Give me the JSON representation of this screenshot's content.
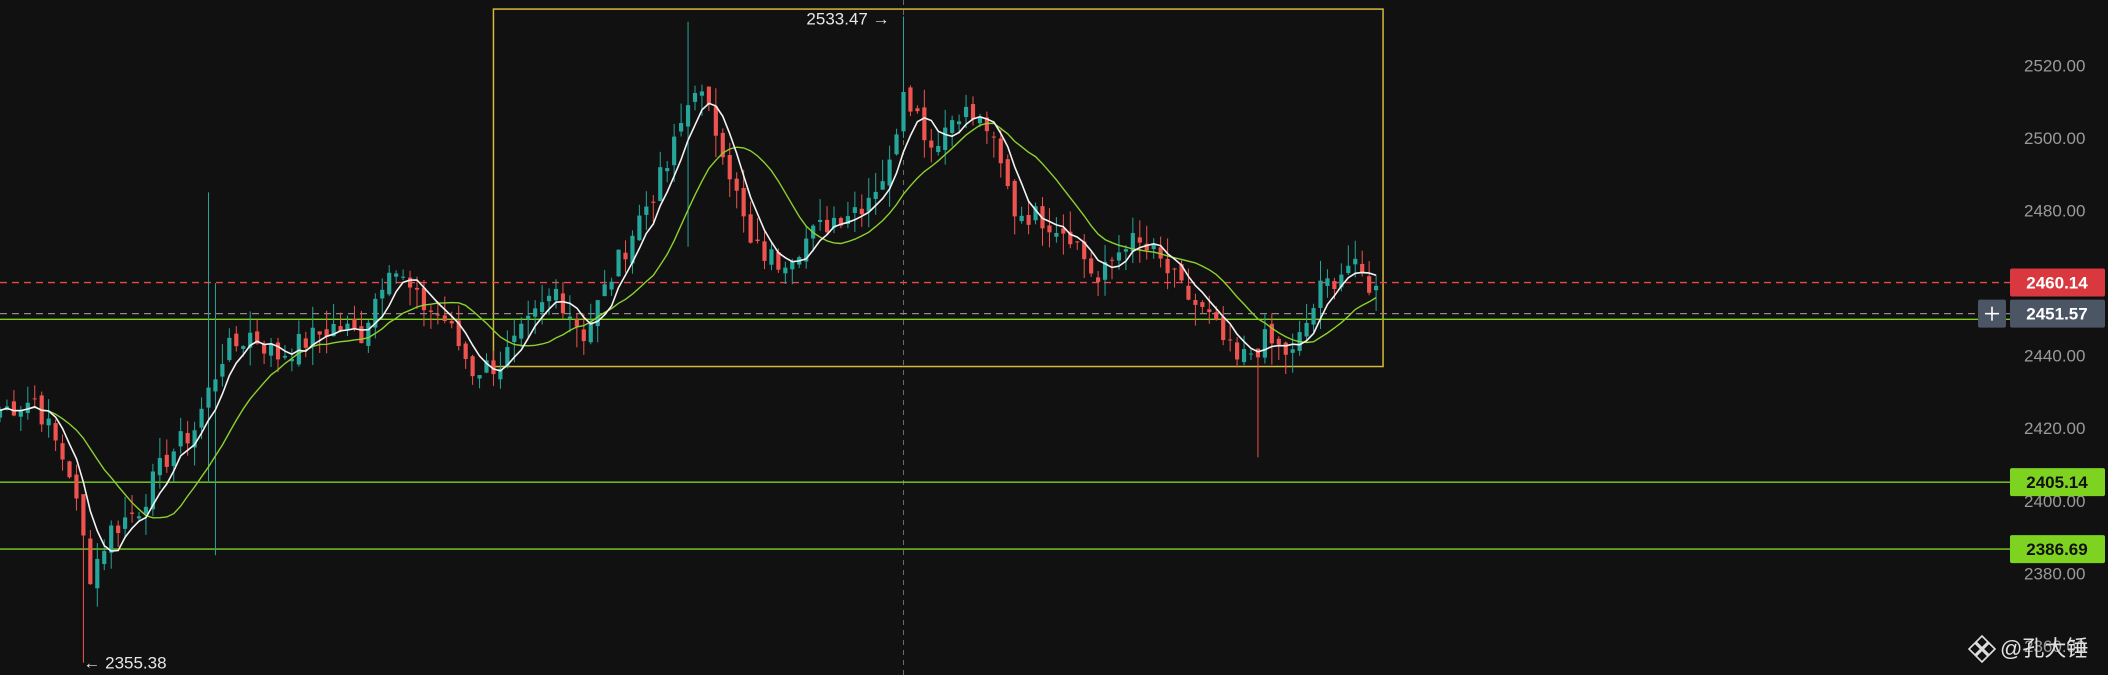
{
  "chart_data": {
    "type": "candlestick",
    "y_axis": {
      "range": [
        2352,
        2538
      ],
      "ticks": [
        2360,
        2380,
        2400,
        2420,
        2440,
        2460,
        2480,
        2500,
        2520
      ],
      "tick_labels": [
        "2360.00",
        "2380.00",
        "2400.00",
        "2420.00",
        "2440.00",
        "2460.00",
        "2480.00",
        "2500.00",
        "2520.00"
      ],
      "position": "right"
    },
    "x_range": [
      0,
      300
    ],
    "grid": false,
    "crosshair": {
      "x": 130,
      "y": 2451.57
    },
    "price_lines": [
      {
        "value": 2460.14,
        "label": "2460.14",
        "style": "dashed",
        "color": "#e8474c",
        "tag_color": "#d9393e",
        "tag_text_color": "#ffffff"
      },
      {
        "value": 2451.57,
        "label": "2451.57",
        "style": "dashed",
        "color": "#8a8a8a",
        "tag_color": "#4b5563",
        "tag_text_color": "#ffffff",
        "has_add_button": true
      },
      {
        "value": 2450.0,
        "label": "",
        "style": "solid",
        "color": "#7ed321",
        "tag_color": "",
        "tag_text_color": ""
      },
      {
        "value": 2405.14,
        "label": "2405.14",
        "style": "solid",
        "color": "#7ed321",
        "tag_color": "#7ed321",
        "tag_text_color": "#111111"
      },
      {
        "value": 2386.69,
        "label": "2386.69",
        "style": "solid",
        "color": "#7ed321",
        "tag_color": "#7ed321",
        "tag_text_color": "#111111"
      }
    ],
    "range_box": {
      "x0": 71,
      "x1": 199,
      "y0": 2437,
      "y1": 2535.5,
      "color": "#d4b93c"
    },
    "annotations": [
      {
        "text": "2533.47 →",
        "x": 128,
        "y": 2533.47,
        "anchor": "end"
      },
      {
        "text": "← 2355.38",
        "x": 12,
        "y": 2355.38,
        "anchor": "start"
      }
    ],
    "series": [
      {
        "name": "",
        "kind": "candles",
        "up_color": "#26a69a",
        "down_color": "#ef5350"
      },
      {
        "name": "",
        "kind": "ma_fast",
        "color": "#f2f2f2"
      },
      {
        "name": "",
        "kind": "ma_slow",
        "color": "#8bd12f"
      }
    ],
    "anchor_closes": [
      [
        0,
        2425
      ],
      [
        5,
        2428
      ],
      [
        10,
        2408
      ],
      [
        13,
        2380
      ],
      [
        16,
        2392
      ],
      [
        20,
        2398
      ],
      [
        24,
        2412
      ],
      [
        28,
        2420
      ],
      [
        32,
        2440
      ],
      [
        36,
        2446
      ],
      [
        40,
        2440
      ],
      [
        44,
        2444
      ],
      [
        48,
        2448
      ],
      [
        52,
        2446
      ],
      [
        56,
        2466
      ],
      [
        60,
        2455
      ],
      [
        64,
        2450
      ],
      [
        68,
        2436
      ],
      [
        72,
        2438
      ],
      [
        76,
        2448
      ],
      [
        80,
        2458
      ],
      [
        84,
        2446
      ],
      [
        88,
        2462
      ],
      [
        92,
        2478
      ],
      [
        96,
        2492
      ],
      [
        100,
        2515
      ],
      [
        104,
        2498
      ],
      [
        108,
        2470
      ],
      [
        112,
        2466
      ],
      [
        116,
        2472
      ],
      [
        120,
        2478
      ],
      [
        124,
        2482
      ],
      [
        128,
        2492
      ],
      [
        130,
        2515
      ],
      [
        134,
        2498
      ],
      [
        138,
        2508
      ],
      [
        142,
        2503
      ],
      [
        146,
        2480
      ],
      [
        150,
        2478
      ],
      [
        154,
        2474
      ],
      [
        158,
        2460
      ],
      [
        162,
        2472
      ],
      [
        166,
        2468
      ],
      [
        170,
        2458
      ],
      [
        174,
        2450
      ],
      [
        178,
        2438
      ],
      [
        182,
        2444
      ],
      [
        186,
        2440
      ],
      [
        190,
        2458
      ],
      [
        194,
        2465
      ],
      [
        198,
        2458
      ]
    ],
    "wick_extremes": [
      {
        "i": 30,
        "high": 2485,
        "low": 2405
      },
      {
        "i": 31,
        "high": 2460,
        "low": 2385
      },
      {
        "i": 99,
        "high": 2532,
        "low": 2470
      },
      {
        "i": 130,
        "high": 2533.47,
        "low": 2500
      },
      {
        "i": 12,
        "high": 2400,
        "low": 2355.38
      },
      {
        "i": 181,
        "high": 2440,
        "low": 2412
      }
    ]
  },
  "watermark": {
    "text": "@孔大锤",
    "icon": "diamond-logo-icon"
  }
}
